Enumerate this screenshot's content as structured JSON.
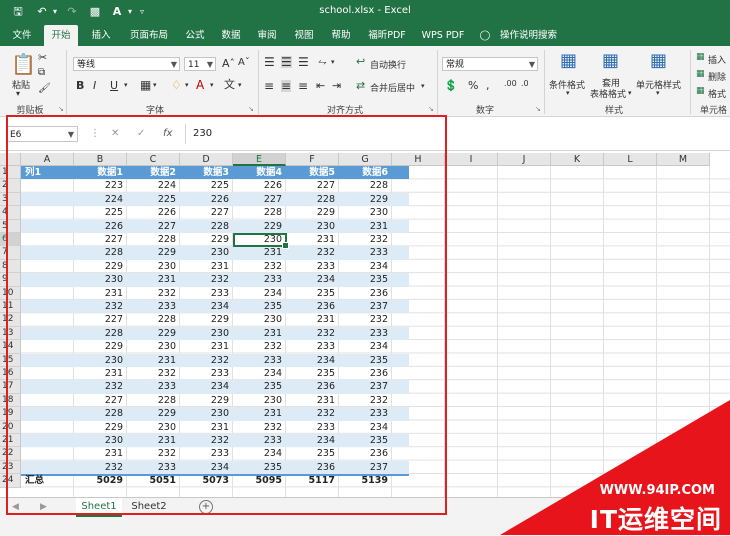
{
  "titlebar": {
    "title": "school.xlsx  -  Excel"
  },
  "tabs": [
    "文件",
    "开始",
    "插入",
    "页面布局",
    "公式",
    "数据",
    "审阅",
    "视图",
    "帮助",
    "福昕PDF",
    "WPS PDF",
    "操作说明搜索"
  ],
  "ribbon": {
    "paste": "粘贴",
    "font_name": "等线",
    "font_size": "11",
    "wrap_text": "自动换行",
    "merge_center": "合并后居中",
    "number_format": "常规",
    "cond_format": "条件格式",
    "table_format_1": "套用",
    "table_format_2": "表格格式",
    "cell_style": "单元格样式",
    "insert": "插入",
    "delete": "删除",
    "format": "格式",
    "groups": {
      "clipboard": "剪贴板",
      "font": "字体",
      "alignment": "对齐方式",
      "number": "数字",
      "styles": "样式",
      "cells": "单元格"
    }
  },
  "formula_bar": {
    "name_box": "E6",
    "fx": "fx",
    "value": "230"
  },
  "sheet": {
    "columns": [
      "A",
      "B",
      "C",
      "D",
      "E",
      "F",
      "G",
      "H",
      "I",
      "J",
      "K",
      "L",
      "M"
    ],
    "header": [
      "列1",
      "数据1",
      "数据2",
      "数据3",
      "数据4",
      "数据5",
      "数据6"
    ],
    "rows": [
      [
        223,
        224,
        225,
        226,
        227,
        228
      ],
      [
        224,
        225,
        226,
        227,
        228,
        229
      ],
      [
        225,
        226,
        227,
        228,
        229,
        230
      ],
      [
        226,
        227,
        228,
        229,
        230,
        231
      ],
      [
        227,
        228,
        229,
        230,
        231,
        232
      ],
      [
        228,
        229,
        230,
        231,
        232,
        233
      ],
      [
        229,
        230,
        231,
        232,
        233,
        234
      ],
      [
        230,
        231,
        232,
        233,
        234,
        235
      ],
      [
        231,
        232,
        233,
        234,
        235,
        236
      ],
      [
        232,
        233,
        234,
        235,
        236,
        237
      ],
      [
        227,
        228,
        229,
        230,
        231,
        232
      ],
      [
        228,
        229,
        230,
        231,
        232,
        233
      ],
      [
        229,
        230,
        231,
        232,
        233,
        234
      ],
      [
        230,
        231,
        232,
        233,
        234,
        235
      ],
      [
        231,
        232,
        233,
        234,
        235,
        236
      ],
      [
        232,
        233,
        234,
        235,
        236,
        237
      ],
      [
        227,
        228,
        229,
        230,
        231,
        232
      ],
      [
        228,
        229,
        230,
        231,
        232,
        233
      ],
      [
        229,
        230,
        231,
        232,
        233,
        234
      ],
      [
        230,
        231,
        232,
        233,
        234,
        235
      ],
      [
        231,
        232,
        233,
        234,
        235,
        236
      ],
      [
        232,
        233,
        234,
        235,
        236,
        237
      ]
    ],
    "total_label": "汇总",
    "totals": [
      5029,
      5051,
      5073,
      5095,
      5117,
      5139
    ],
    "row_numbers": [
      "1",
      "2",
      "3",
      "4",
      "5",
      "6",
      "7",
      "8",
      "9",
      "10",
      "11",
      "12",
      "13",
      "14",
      "15",
      "16",
      "17",
      "18",
      "19",
      "20",
      "21",
      "22",
      "23",
      "24"
    ],
    "selected_cell": "E6",
    "header_color": "#5b9bd5",
    "band_color": "#ddebf7",
    "accent_color": "#217346"
  },
  "sheet_tabs": [
    "Sheet1",
    "Sheet2"
  ],
  "watermark": {
    "url": "WWW.94IP.COM",
    "text": "IT运维空间"
  }
}
